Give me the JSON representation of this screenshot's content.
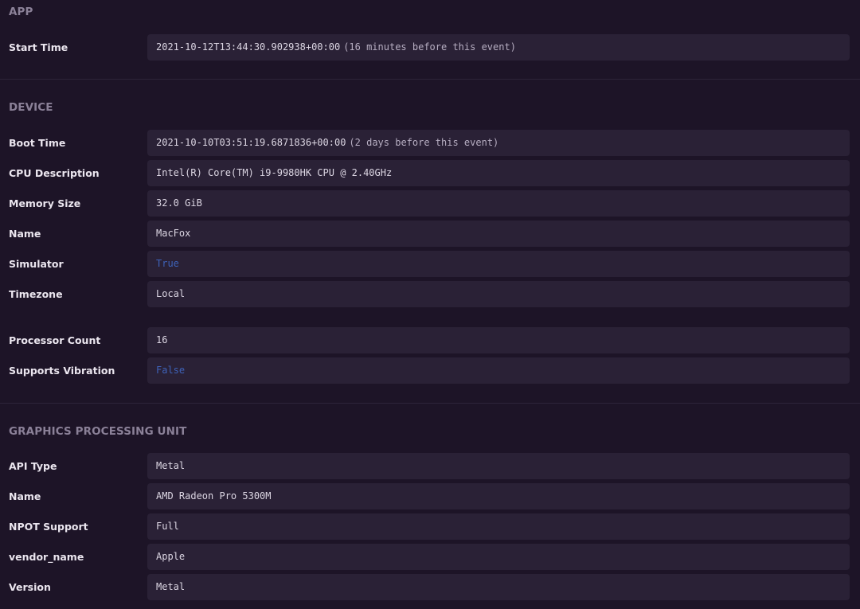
{
  "sections": {
    "app": {
      "title": "APP",
      "rows": [
        {
          "label": "Start Time",
          "value": "2021-10-12T13:44:30.902938+00:00",
          "relative": "(16 minutes before this event)"
        }
      ]
    },
    "device": {
      "title": "DEVICE",
      "rows": [
        {
          "label": "Boot Time",
          "value": "2021-10-10T03:51:19.6871836+00:00",
          "relative": "(2 days before this event)"
        },
        {
          "label": "CPU Description",
          "value": "Intel(R) Core(TM) i9-9980HK CPU @ 2.40GHz"
        },
        {
          "label": "Memory Size",
          "value": "32.0 GiB"
        },
        {
          "label": "Name",
          "value": "MacFox"
        },
        {
          "label": "Simulator",
          "value": "True"
        },
        {
          "label": "Timezone",
          "value": "Local"
        },
        {
          "label": "Processor Count",
          "value": "16"
        },
        {
          "label": "Supports Vibration",
          "value": "False"
        }
      ]
    },
    "gpu": {
      "title": "GRAPHICS PROCESSING UNIT",
      "rows": [
        {
          "label": "API Type",
          "value": "Metal"
        },
        {
          "label": "Name",
          "value": "AMD Radeon Pro 5300M"
        },
        {
          "label": "NPOT Support",
          "value": "Full"
        },
        {
          "label": "vendor_name",
          "value": "Apple"
        },
        {
          "label": "Version",
          "value": "Metal"
        }
      ]
    }
  },
  "colors": {
    "background": "#1d1427",
    "value_background": "#2a2136",
    "boolean_value": "#3e62b8",
    "section_title": "#8b8198"
  }
}
